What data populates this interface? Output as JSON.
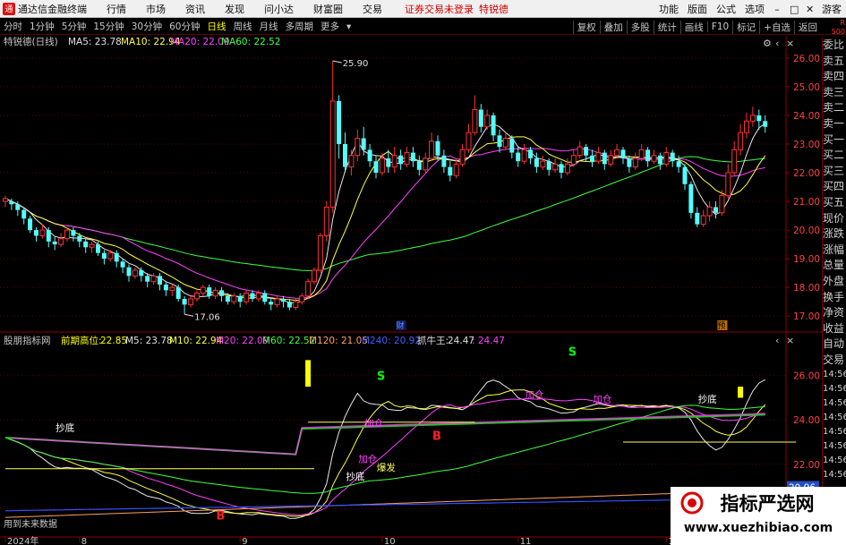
{
  "app": {
    "title": "通达信金融终端",
    "logo_glyph": "通",
    "warning": "证券交易未登录",
    "stock_name_top": "特锐德"
  },
  "menu": {
    "items": [
      "行情",
      "市场",
      "资讯",
      "发现",
      "问小达",
      "财富圈",
      "交易"
    ]
  },
  "menu_right": {
    "items": [
      "功能",
      "版面",
      "公式",
      "选项"
    ],
    "guest": "游客"
  },
  "toolbar": {
    "timeframes": [
      "分时",
      "1分钟",
      "5分钟",
      "15分钟",
      "30分钟",
      "60分钟",
      "日线",
      "周线",
      "月线",
      "多周期",
      "更多"
    ],
    "active": "日线",
    "right": [
      "复权",
      "叠加",
      "多股",
      "统计",
      "画线",
      "F10",
      "标记",
      "+自选",
      "返回"
    ]
  },
  "badge": {
    "r": "R",
    "num": "500"
  },
  "sidebar": {
    "items": [
      "委比",
      "卖五",
      "卖四",
      "卖三",
      "卖二",
      "卖一",
      "买一",
      "买二",
      "买三",
      "买四",
      "买五",
      "现价",
      "涨跌",
      "涨幅",
      "总量",
      "外盘",
      "换手",
      "净资",
      "收益",
      "自动",
      "交易"
    ],
    "times": [
      "14:56",
      "14:56",
      "14:56",
      "14:56",
      "14:56",
      "14:56",
      "14:56",
      "14:56"
    ]
  },
  "main_legend": {
    "name": "特锐德(日线)",
    "ma5": "MA5: 23.78",
    "ma10": "MA10: 22.94",
    "ma20": "MA20: 22.09",
    "ma60": "MA60: 22.52"
  },
  "sub_legend": {
    "name": "股朋指标网",
    "prev_high_label": "前期高位:",
    "prev_high": "22.85",
    "m5": "M5: 23.78",
    "m10": "M10: 22.94",
    "m20": "M20: 22.09",
    "m60": "M60: 22.52",
    "m120": "M120: 21.05",
    "m240": "M240: 20.92",
    "zhua_label": "抓牛王:",
    "zhua": "24.47",
    "zhua2": ": 24.47"
  },
  "chart_data": {
    "type": "candlestick",
    "price_axis": {
      "ticks": [
        "26.00",
        "25.00",
        "24.00",
        "23.00",
        "22.00",
        "21.00",
        "20.00",
        "19.00",
        "18.00",
        "17.00"
      ],
      "ylim": [
        16.6,
        26.4
      ]
    },
    "sub_axis": {
      "ticks": [
        "26.00",
        "24.00",
        "22.00",
        "20.00"
      ],
      "ylim": [
        18.8,
        27.2
      ],
      "current": "20.96"
    },
    "x_labels": [
      {
        "label": "2024年",
        "i": 0
      },
      {
        "label": "8",
        "i": 12
      },
      {
        "label": "9",
        "i": 38
      },
      {
        "label": "10",
        "i": 61
      },
      {
        "label": "11",
        "i": 83
      },
      {
        "label": "12",
        "i": 107
      },
      {
        "label": "1",
        "i": 130
      }
    ],
    "high_label": "25.90",
    "low_label": "17.06",
    "cai_label": "财",
    "yu_label": "预",
    "annotations": [
      {
        "t": "S",
        "c": "#00ff00",
        "i": 61,
        "v": 25.8
      },
      {
        "t": "S",
        "c": "#00ff00",
        "i": 92,
        "v": 26.9
      },
      {
        "t": "S",
        "c": "#00ff00",
        "i": 147,
        "v": 25.2
      },
      {
        "t": "B",
        "c": "#ff2020",
        "i": 35,
        "v": 19.5
      },
      {
        "t": "B",
        "c": "#ff2020",
        "i": 70,
        "v": 23.1
      },
      {
        "t": "B",
        "c": "#ff2020",
        "i": 134,
        "v": 20.8
      },
      {
        "t": "抄底",
        "c": "#ffffff",
        "i": 9,
        "v": 23.5
      },
      {
        "t": "抄底",
        "c": "#ffffff",
        "i": 56,
        "v": 21.3
      },
      {
        "t": "抄底",
        "c": "#ffffff",
        "i": 113,
        "v": 24.8
      },
      {
        "t": "抄底",
        "c": "#ffffff",
        "i": 141,
        "v": 24.1
      },
      {
        "t": "加仓",
        "c": "#ff40ff",
        "i": 59,
        "v": 23.7
      },
      {
        "t": "加仓",
        "c": "#ff40ff",
        "i": 58,
        "v": 22.1
      },
      {
        "t": "加仓",
        "c": "#ff40ff",
        "i": 85,
        "v": 25.0
      },
      {
        "t": "加仓",
        "c": "#ff40ff",
        "i": 96,
        "v": 24.8
      },
      {
        "t": "加仓",
        "c": "#ff40ff",
        "i": 145,
        "v": 24.6
      },
      {
        "t": "爆发",
        "c": "#ffff60",
        "i": 61,
        "v": 21.7
      },
      {
        "t": "爆发",
        "c": "#ffff60",
        "i": 146,
        "v": 24.4
      }
    ],
    "footer_note": "用到未来数据",
    "candles": [
      [
        21.0,
        21.1,
        20.8,
        21.2
      ],
      [
        21.0,
        20.9,
        20.7,
        21.1
      ],
      [
        20.9,
        20.7,
        20.5,
        21.0
      ],
      [
        20.7,
        20.4,
        20.2,
        20.8
      ],
      [
        20.4,
        20.0,
        19.9,
        20.5
      ],
      [
        20.0,
        19.8,
        19.6,
        20.1
      ],
      [
        19.8,
        20.0,
        19.7,
        20.2
      ],
      [
        20.0,
        19.6,
        19.4,
        20.1
      ],
      [
        19.6,
        19.5,
        19.3,
        19.8
      ],
      [
        19.5,
        19.7,
        19.4,
        19.9
      ],
      [
        19.7,
        20.0,
        19.6,
        20.1
      ],
      [
        20.0,
        19.8,
        19.6,
        20.1
      ],
      [
        19.8,
        19.6,
        19.4,
        19.9
      ],
      [
        19.6,
        19.4,
        19.2,
        19.7
      ],
      [
        19.4,
        19.5,
        19.2,
        19.6
      ],
      [
        19.5,
        19.2,
        19.1,
        19.6
      ],
      [
        19.2,
        19.0,
        18.8,
        19.3
      ],
      [
        19.0,
        19.2,
        18.9,
        19.3
      ],
      [
        19.2,
        18.9,
        18.7,
        19.3
      ],
      [
        18.9,
        18.7,
        18.5,
        19.0
      ],
      [
        18.7,
        18.4,
        18.2,
        18.8
      ],
      [
        18.4,
        18.6,
        18.3,
        18.7
      ],
      [
        18.6,
        18.4,
        18.2,
        18.7
      ],
      [
        18.4,
        18.2,
        18.0,
        18.5
      ],
      [
        18.2,
        18.4,
        18.1,
        18.5
      ],
      [
        18.4,
        18.1,
        17.9,
        18.5
      ],
      [
        18.1,
        17.9,
        17.7,
        18.2
      ],
      [
        17.9,
        18.0,
        17.7,
        18.1
      ],
      [
        18.0,
        17.6,
        17.5,
        18.1
      ],
      [
        17.6,
        17.4,
        17.06,
        17.7
      ],
      [
        17.4,
        17.6,
        17.3,
        17.7
      ],
      [
        17.6,
        17.8,
        17.5,
        17.9
      ],
      [
        17.8,
        18.0,
        17.7,
        18.1
      ],
      [
        18.0,
        17.7,
        17.6,
        18.1
      ],
      [
        17.7,
        17.9,
        17.6,
        18.0
      ],
      [
        17.9,
        17.7,
        17.5,
        18.0
      ],
      [
        17.7,
        17.5,
        17.4,
        17.8
      ],
      [
        17.5,
        17.7,
        17.4,
        17.8
      ],
      [
        17.7,
        17.5,
        17.3,
        17.8
      ],
      [
        17.5,
        17.8,
        17.4,
        17.9
      ],
      [
        17.8,
        17.6,
        17.5,
        17.9
      ],
      [
        17.6,
        17.8,
        17.5,
        17.9
      ],
      [
        17.8,
        17.5,
        17.4,
        17.9
      ],
      [
        17.5,
        17.4,
        17.2,
        17.6
      ],
      [
        17.4,
        17.6,
        17.3,
        17.7
      ],
      [
        17.6,
        17.5,
        17.3,
        17.7
      ],
      [
        17.5,
        17.3,
        17.2,
        17.6
      ],
      [
        17.3,
        17.5,
        17.2,
        17.6
      ],
      [
        17.5,
        17.7,
        17.4,
        17.8
      ],
      [
        17.7,
        18.2,
        17.6,
        18.3
      ],
      [
        18.2,
        18.6,
        18.1,
        18.7
      ],
      [
        18.6,
        19.8,
        18.5,
        19.9
      ],
      [
        19.8,
        20.8,
        19.6,
        21.0
      ],
      [
        20.8,
        24.5,
        20.6,
        25.9
      ],
      [
        24.5,
        23.0,
        22.5,
        24.7
      ],
      [
        23.0,
        22.2,
        22.0,
        23.4
      ],
      [
        22.2,
        22.6,
        21.9,
        22.8
      ],
      [
        22.6,
        23.2,
        22.4,
        23.5
      ],
      [
        23.2,
        22.8,
        22.6,
        23.6
      ],
      [
        22.8,
        22.4,
        22.2,
        23.0
      ],
      [
        22.4,
        22.0,
        21.8,
        22.6
      ],
      [
        22.0,
        22.5,
        21.9,
        22.7
      ],
      [
        22.5,
        22.2,
        22.0,
        22.8
      ],
      [
        22.2,
        22.6,
        22.0,
        22.9
      ],
      [
        22.6,
        22.3,
        22.1,
        22.8
      ],
      [
        22.3,
        22.7,
        22.2,
        22.9
      ],
      [
        22.7,
        22.4,
        22.2,
        22.9
      ],
      [
        22.4,
        22.1,
        21.9,
        22.6
      ],
      [
        22.1,
        22.5,
        22.0,
        22.7
      ],
      [
        22.5,
        23.1,
        22.4,
        23.4
      ],
      [
        23.1,
        22.6,
        22.4,
        23.3
      ],
      [
        22.6,
        22.2,
        22.0,
        22.8
      ],
      [
        22.2,
        21.9,
        21.7,
        22.4
      ],
      [
        21.9,
        22.3,
        21.8,
        22.5
      ],
      [
        22.3,
        22.8,
        22.2,
        23.0
      ],
      [
        22.8,
        23.4,
        22.7,
        23.7
      ],
      [
        23.4,
        24.2,
        23.3,
        24.7
      ],
      [
        24.2,
        23.6,
        23.4,
        24.4
      ],
      [
        23.6,
        24.0,
        23.5,
        24.2
      ],
      [
        24.0,
        23.3,
        23.1,
        24.1
      ],
      [
        23.3,
        22.9,
        22.7,
        23.5
      ],
      [
        22.9,
        23.2,
        22.8,
        23.4
      ],
      [
        23.2,
        22.7,
        22.5,
        23.3
      ],
      [
        22.7,
        22.4,
        22.2,
        22.9
      ],
      [
        22.4,
        22.8,
        22.3,
        23.0
      ],
      [
        22.8,
        22.5,
        22.3,
        22.9
      ],
      [
        22.5,
        22.2,
        22.0,
        22.7
      ],
      [
        22.2,
        22.4,
        22.1,
        22.6
      ],
      [
        22.4,
        22.1,
        21.9,
        22.5
      ],
      [
        22.1,
        22.3,
        22.0,
        22.5
      ],
      [
        22.3,
        22.0,
        21.8,
        22.4
      ],
      [
        22.0,
        22.3,
        21.9,
        22.5
      ],
      [
        22.3,
        22.6,
        22.2,
        22.8
      ],
      [
        22.6,
        22.9,
        22.5,
        23.1
      ],
      [
        22.9,
        22.6,
        22.4,
        23.0
      ],
      [
        22.6,
        22.4,
        22.2,
        22.8
      ],
      [
        22.4,
        22.7,
        22.3,
        22.9
      ],
      [
        22.7,
        22.3,
        22.1,
        22.8
      ],
      [
        22.3,
        22.6,
        22.2,
        22.8
      ],
      [
        22.6,
        22.8,
        22.5,
        23.0
      ],
      [
        22.8,
        22.5,
        22.3,
        22.9
      ],
      [
        22.5,
        22.2,
        22.0,
        22.6
      ],
      [
        22.2,
        22.5,
        22.1,
        22.7
      ],
      [
        22.5,
        22.8,
        22.4,
        23.0
      ],
      [
        22.8,
        22.4,
        22.2,
        22.9
      ],
      [
        22.4,
        22.6,
        22.3,
        22.8
      ],
      [
        22.6,
        22.3,
        22.1,
        22.7
      ],
      [
        22.3,
        22.7,
        22.2,
        22.9
      ],
      [
        22.7,
        22.4,
        22.2,
        22.8
      ],
      [
        22.4,
        22.2,
        22.0,
        22.6
      ],
      [
        22.2,
        21.6,
        21.4,
        22.3
      ],
      [
        21.6,
        20.6,
        20.4,
        21.7
      ],
      [
        20.6,
        20.2,
        20.1,
        20.8
      ],
      [
        20.2,
        20.5,
        20.1,
        20.7
      ],
      [
        20.5,
        20.8,
        20.3,
        21.0
      ],
      [
        20.8,
        20.6,
        20.4,
        21.0
      ],
      [
        20.6,
        21.2,
        20.5,
        21.4
      ],
      [
        21.2,
        22.0,
        21.1,
        22.3
      ],
      [
        22.0,
        22.8,
        21.9,
        23.1
      ],
      [
        22.8,
        23.4,
        22.6,
        23.7
      ],
      [
        23.4,
        23.8,
        23.2,
        24.1
      ],
      [
        23.8,
        24.0,
        23.6,
        24.3
      ],
      [
        24.0,
        23.8,
        23.5,
        24.2
      ],
      [
        23.8,
        23.6,
        23.4,
        24.0
      ]
    ]
  }
}
